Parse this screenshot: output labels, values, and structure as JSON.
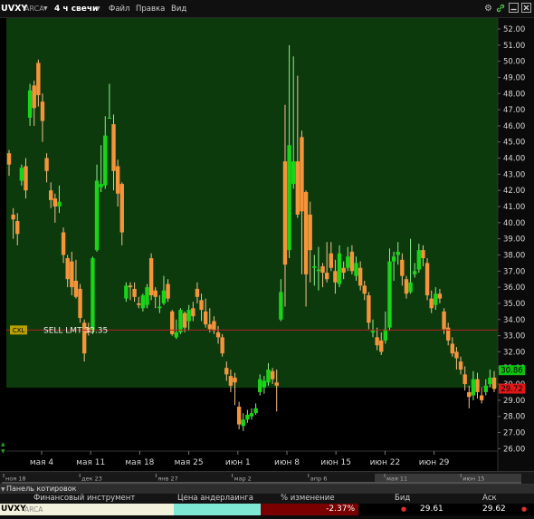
{
  "window": {
    "symbol": "UVXY",
    "exchange": "ARCA",
    "period": "4 ч свечи",
    "menu": [
      "Файл",
      "Правка",
      "Вид"
    ],
    "icons": [
      "gear-icon",
      "link-icon",
      "minimize-icon",
      "close-icon"
    ]
  },
  "chart_data": {
    "type": "candlestick",
    "y_axis": {
      "min": 25,
      "max": 52.5,
      "ticks": [
        "52.00",
        "51.00",
        "50.00",
        "49.00",
        "48.00",
        "47.00",
        "46.00",
        "45.00",
        "44.00",
        "43.00",
        "42.00",
        "41.00",
        "40.00",
        "39.00",
        "38.00",
        "37.00",
        "36.00",
        "35.00",
        "34.00",
        "33.00",
        "32.00",
        "31.00",
        "30.00",
        "29.00",
        "28.00",
        "27.00",
        "26.00"
      ]
    },
    "x_axis": {
      "labels": [
        "мая 4",
        "мая 11",
        "мая 18",
        "мая 25",
        "июн 1",
        "июн 8",
        "июн 15",
        "июн 22",
        "июн 29"
      ]
    },
    "navigator_labels": [
      "ноя 18",
      "дек 23",
      "янв 27",
      "мар 2",
      "апр 6",
      "мая 11",
      "июн 15"
    ],
    "order_line": {
      "label": "SELL LMT 33.35",
      "tag": "CXL",
      "price": 33.35
    },
    "last_price_green": "30.86",
    "last_price_red": "29.72",
    "colors": {
      "up": "#19d419",
      "down": "#f5943a",
      "background_upper": "#0d3a0d",
      "order_line": "#c03030"
    },
    "candles": [
      [
        44.3,
        43.6,
        44.5,
        42.9
      ],
      [
        40.5,
        40.2,
        40.9,
        39.0
      ],
      [
        40.1,
        39.3,
        40.6,
        38.6
      ],
      [
        42.6,
        43.4,
        43.6,
        42.3
      ],
      [
        43.5,
        42.0,
        44.0,
        41.5
      ],
      [
        46.5,
        48.2,
        48.6,
        46.0
      ],
      [
        48.5,
        47.1,
        48.8,
        46.0
      ],
      [
        49.9,
        47.9,
        50.1,
        47.2
      ],
      [
        47.5,
        46.3,
        48.0,
        45.0
      ],
      [
        44.0,
        43.2,
        44.3,
        42.5
      ],
      [
        42.0,
        41.4,
        42.5,
        40.9
      ],
      [
        41.5,
        41.0,
        41.8,
        40.0
      ],
      [
        41.0,
        41.3,
        42.3,
        40.6
      ],
      [
        39.4,
        38.0,
        39.7,
        37.5
      ],
      [
        37.8,
        36.5,
        38.0,
        36.0
      ],
      [
        37.6,
        36.0,
        38.2,
        35.5
      ],
      [
        36.4,
        35.4,
        37.7,
        35.3
      ],
      [
        35.9,
        34.1,
        36.2,
        33.8
      ],
      [
        33.8,
        31.9,
        34.0,
        31.4
      ],
      [
        33.5,
        33.2,
        33.8,
        33.0
      ],
      [
        33.3,
        37.8,
        37.9,
        33.1
      ],
      [
        38.3,
        42.6,
        43.6,
        38.2
      ],
      [
        42.2,
        42.4,
        44.8,
        41.9
      ],
      [
        42.3,
        45.4,
        46.6,
        42.1
      ],
      [
        46.5,
        46.5,
        48.6,
        46.5
      ],
      [
        46.1,
        43.2,
        46.7,
        42.0
      ],
      [
        43.5,
        41.8,
        43.9,
        41.0
      ],
      [
        42.4,
        39.4,
        42.5,
        38.6
      ],
      [
        35.3,
        36.1,
        36.3,
        35.1
      ],
      [
        36.1,
        36.0,
        36.3,
        35.2
      ],
      [
        35.9,
        35.4,
        36.3,
        35.1
      ],
      [
        35.0,
        34.9,
        35.4,
        34.7
      ],
      [
        34.7,
        35.5,
        35.6,
        34.5
      ],
      [
        34.9,
        36.0,
        36.2,
        34.7
      ],
      [
        37.8,
        35.5,
        38.1,
        35.2
      ],
      [
        35.8,
        35.4,
        36.0,
        34.7
      ],
      [
        34.7,
        34.8,
        35.5,
        34.4
      ],
      [
        35.0,
        35.8,
        36.7,
        34.9
      ],
      [
        36.2,
        35.3,
        36.5,
        35.1
      ],
      [
        34.5,
        33.1,
        34.6,
        33.0
      ],
      [
        32.9,
        33.2,
        34.0,
        32.8
      ],
      [
        33.2,
        34.6,
        34.7,
        33.1
      ],
      [
        34.4,
        33.5,
        34.5,
        33.2
      ],
      [
        33.9,
        34.6,
        34.9,
        33.3
      ],
      [
        34.7,
        34.2,
        35.1,
        33.9
      ],
      [
        35.9,
        35.4,
        36.3,
        35.0
      ],
      [
        35.2,
        34.6,
        35.6,
        33.9
      ],
      [
        34.5,
        33.7,
        35.3,
        33.5
      ],
      [
        33.7,
        33.4,
        34.7,
        33.2
      ],
      [
        33.9,
        33.3,
        34.2,
        33.1
      ],
      [
        33.2,
        32.9,
        33.6,
        32.5
      ],
      [
        32.9,
        31.9,
        33.1,
        31.7
      ],
      [
        31.0,
        30.6,
        31.4,
        30.2
      ],
      [
        30.5,
        29.9,
        30.9,
        29.5
      ],
      [
        30.4,
        30.1,
        30.7,
        28.7
      ],
      [
        28.6,
        27.5,
        28.9,
        27.2
      ],
      [
        27.4,
        27.8,
        28.2,
        27.1
      ],
      [
        27.8,
        28.1,
        28.4,
        27.6
      ],
      [
        28.0,
        28.2,
        28.5,
        27.8
      ],
      [
        28.2,
        28.5,
        28.8,
        28.1
      ],
      [
        29.5,
        30.3,
        30.6,
        29.3
      ],
      [
        29.8,
        30.2,
        30.5,
        29.4
      ],
      [
        30.1,
        30.9,
        31.3,
        29.9
      ],
      [
        30.8,
        30.3,
        31.0,
        30.0
      ],
      [
        30.1,
        29.9,
        30.9,
        28.3
      ],
      [
        34.0,
        35.7,
        36.5,
        33.9
      ],
      [
        43.8,
        37.4,
        47.3,
        34.8
      ],
      [
        38.3,
        44.8,
        51.0,
        37.8
      ],
      [
        42.4,
        43.8,
        50.3,
        42.1
      ],
      [
        43.8,
        40.5,
        49.1,
        40.3
      ],
      [
        45.3,
        40.7,
        45.7,
        36.8
      ],
      [
        41.9,
        36.8,
        42.0,
        34.8
      ],
      [
        40.5,
        38.3,
        41.3,
        36.3
      ],
      [
        37.2,
        37.3,
        38.0,
        36.1
      ],
      [
        37.0,
        37.1,
        38.5,
        35.8
      ],
      [
        37.3,
        36.9,
        37.5,
        36.0
      ],
      [
        36.9,
        36.5,
        38.8,
        36.3
      ],
      [
        38.1,
        37.2,
        38.8,
        37.0
      ],
      [
        37.0,
        36.3,
        37.7,
        35.6
      ],
      [
        36.2,
        38.1,
        38.6,
        36.0
      ],
      [
        37.2,
        36.9,
        37.6,
        36.5
      ],
      [
        37.2,
        37.9,
        38.5,
        37.0
      ],
      [
        38.2,
        37.0,
        38.6,
        36.8
      ],
      [
        36.7,
        37.5,
        37.9,
        36.4
      ],
      [
        37.2,
        36.1,
        37.6,
        35.8
      ],
      [
        36.1,
        35.6,
        36.4,
        35.2
      ],
      [
        35.5,
        33.8,
        35.7,
        33.4
      ],
      [
        33.2,
        33.3,
        34.0,
        32.9
      ],
      [
        32.9,
        32.4,
        33.5,
        32.1
      ],
      [
        32.7,
        32.0,
        33.2,
        31.8
      ],
      [
        32.7,
        33.4,
        34.5,
        32.5
      ],
      [
        33.5,
        37.6,
        38.4,
        33.3
      ],
      [
        37.6,
        37.9,
        38.2,
        36.4
      ],
      [
        38.0,
        38.2,
        38.8,
        37.4
      ],
      [
        37.7,
        36.7,
        38.1,
        36.1
      ],
      [
        36.5,
        35.6,
        36.7,
        35.3
      ],
      [
        35.7,
        36.3,
        39.0,
        35.6
      ],
      [
        36.8,
        37.0,
        37.5,
        36.6
      ],
      [
        37.1,
        38.3,
        38.7,
        36.9
      ],
      [
        38.3,
        37.8,
        38.6,
        37.3
      ],
      [
        37.5,
        35.5,
        37.8,
        35.2
      ],
      [
        35.3,
        34.7,
        35.8,
        34.4
      ],
      [
        34.9,
        35.6,
        36.0,
        34.6
      ],
      [
        35.6,
        35.3,
        35.9,
        35.0
      ],
      [
        34.5,
        33.4,
        34.7,
        33.1
      ],
      [
        33.5,
        32.7,
        33.8,
        32.4
      ],
      [
        32.5,
        31.9,
        32.9,
        31.7
      ],
      [
        32.0,
        31.6,
        32.3,
        30.9
      ],
      [
        31.4,
        30.9,
        31.7,
        30.6
      ],
      [
        30.6,
        30.0,
        31.1,
        29.6
      ],
      [
        29.5,
        29.2,
        29.9,
        28.5
      ],
      [
        29.3,
        30.3,
        30.8,
        29.0
      ],
      [
        30.3,
        29.5,
        30.7,
        29.1
      ],
      [
        29.3,
        29.0,
        29.8,
        28.8
      ],
      [
        29.5,
        29.9,
        30.3,
        29.3
      ],
      [
        30.0,
        30.4,
        30.9,
        29.8
      ],
      [
        30.4,
        29.7,
        30.8,
        29.5
      ]
    ]
  },
  "quote_panel": {
    "title": "Панель котировок",
    "columns": [
      "Финансовый инструмент",
      "Цена андерлаинга",
      "% изменение",
      "Бид",
      "Аск"
    ],
    "row": {
      "symbol": "UVXY",
      "exchange": "ARCA",
      "underlying_price": "",
      "change_pct": "-2.37%",
      "bid": "29.61",
      "ask": "29.62"
    }
  }
}
